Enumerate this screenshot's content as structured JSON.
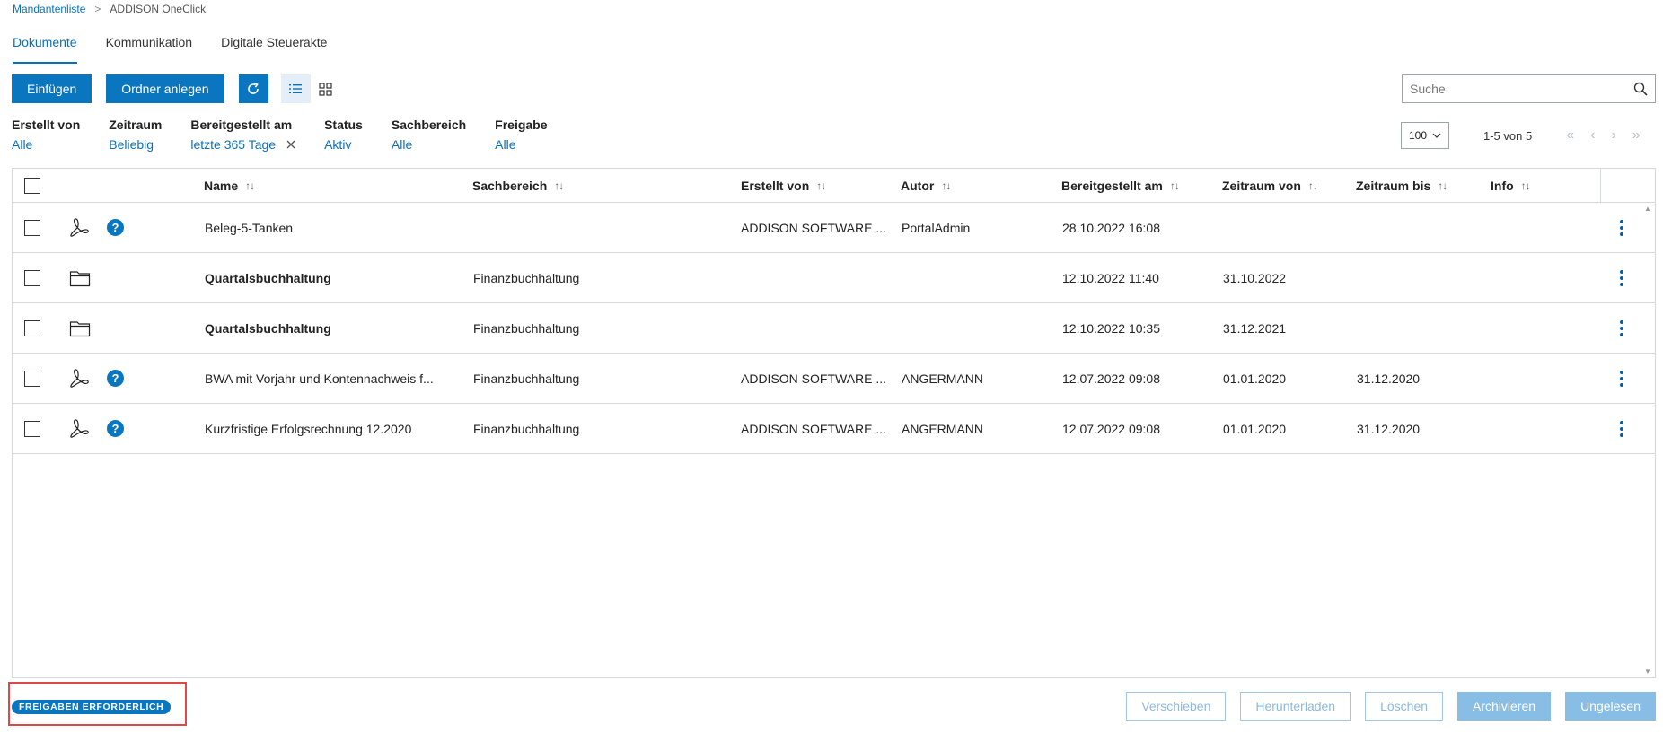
{
  "breadcrumb": {
    "link": "Mandantenliste",
    "separator": ">",
    "current": "ADDISON OneClick"
  },
  "tabs": [
    {
      "label": "Dokumente",
      "active": true
    },
    {
      "label": "Kommunikation",
      "active": false
    },
    {
      "label": "Digitale Steuerakte",
      "active": false
    }
  ],
  "toolbar": {
    "insert_label": "Einfügen",
    "create_folder_label": "Ordner anlegen"
  },
  "search": {
    "placeholder": "Suche"
  },
  "filters": [
    {
      "label": "Erstellt von",
      "value": "Alle"
    },
    {
      "label": "Zeitraum",
      "value": "Beliebig"
    },
    {
      "label": "Bereitgestellt am",
      "value": "letzte 365 Tage",
      "clearable": true
    },
    {
      "label": "Status",
      "value": "Aktiv"
    },
    {
      "label": "Sachbereich",
      "value": "Alle"
    },
    {
      "label": "Freigabe",
      "value": "Alle"
    }
  ],
  "pager": {
    "page_size": "100",
    "range": "1-5 von 5"
  },
  "table": {
    "columns": [
      "Name",
      "Sachbereich",
      "Erstellt von",
      "Autor",
      "Bereitgestellt am",
      "Zeitraum von",
      "Zeitraum bis",
      "Info"
    ],
    "rows": [
      {
        "type": "pdf",
        "help": true,
        "name": "Beleg-5-Tanken",
        "sachbereich": "",
        "erstellt_von": "ADDISON SOFTWARE ...",
        "autor": "PortalAdmin",
        "bereitgestellt": "28.10.2022 16:08",
        "zeitraum_von": "",
        "zeitraum_bis": ""
      },
      {
        "type": "folder",
        "help": false,
        "name": "Quartalsbuchhaltung",
        "sachbereich": "Finanzbuchhaltung",
        "erstellt_von": "",
        "autor": "",
        "bereitgestellt": "12.10.2022 11:40",
        "zeitraum_von": "31.10.2022",
        "zeitraum_bis": ""
      },
      {
        "type": "folder",
        "help": false,
        "name": "Quartalsbuchhaltung",
        "sachbereich": "Finanzbuchhaltung",
        "erstellt_von": "",
        "autor": "",
        "bereitgestellt": "12.10.2022 10:35",
        "zeitraum_von": "31.12.2021",
        "zeitraum_bis": ""
      },
      {
        "type": "pdf",
        "help": true,
        "name": "BWA mit Vorjahr und Kontennachweis f...",
        "sachbereich": "Finanzbuchhaltung",
        "erstellt_von": "ADDISON SOFTWARE ...",
        "autor": "ANGERMANN",
        "bereitgestellt": "12.07.2022 09:08",
        "zeitraum_von": "01.01.2020",
        "zeitraum_bis": "31.12.2020"
      },
      {
        "type": "pdf",
        "help": true,
        "name": "Kurzfristige Erfolgsrechnung 12.2020",
        "sachbereich": "Finanzbuchhaltung",
        "erstellt_von": "ADDISON SOFTWARE ...",
        "autor": "ANGERMANN",
        "bereitgestellt": "12.07.2022 09:08",
        "zeitraum_von": "01.01.2020",
        "zeitraum_bis": "31.12.2020"
      }
    ],
    "help_glyph": "?"
  },
  "footer": {
    "badge": "FREIGABEN ERFORDERLICH",
    "actions": [
      "Verschieben",
      "Herunterladen",
      "Löschen",
      "Archivieren",
      "Ungelesen"
    ]
  },
  "colors": {
    "accent": "#0a76bf",
    "link": "#0a70b8",
    "highlight_box": "#e04848"
  },
  "icons": [
    "refresh-icon",
    "list-view-icon",
    "grid-view-icon",
    "search-icon",
    "pdf-icon",
    "folder-icon",
    "help-icon",
    "kebab-menu-icon",
    "sort-icon",
    "clear-icon",
    "chevron-down-icon"
  ]
}
